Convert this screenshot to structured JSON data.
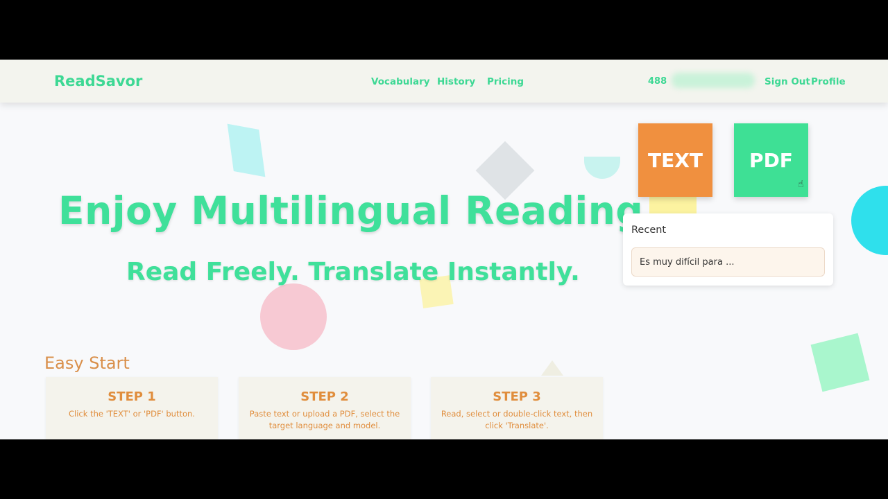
{
  "nav": {
    "logo": "ReadSavor",
    "links": [
      "Vocabulary",
      "History",
      "Pricing"
    ],
    "credits": "488",
    "sign_out": "Sign Out",
    "profile": "Profile"
  },
  "hero": {
    "title": "Enjoy Multilingual Reading",
    "subtitle": "Read Freely. Translate Instantly."
  },
  "actions": {
    "text_label": "TEXT",
    "pdf_label": "PDF"
  },
  "recent": {
    "title": "Recent",
    "items": [
      "Es muy difícil para ..."
    ]
  },
  "easy_start": {
    "title": "Easy Start",
    "steps": [
      {
        "title": "STEP 1",
        "desc": "Click the 'TEXT' or 'PDF' button."
      },
      {
        "title": "STEP 2",
        "desc": "Paste text or upload a PDF, select the target language and model."
      },
      {
        "title": "STEP 3",
        "desc": "Read, select or double-click text, then click 'Translate'."
      }
    ]
  },
  "colors": {
    "brand_green": "#3dd894",
    "text_tile": "#f0903f",
    "step_orange": "#e08d3c"
  },
  "icons": {
    "cursor": "hand-pointer-icon"
  }
}
